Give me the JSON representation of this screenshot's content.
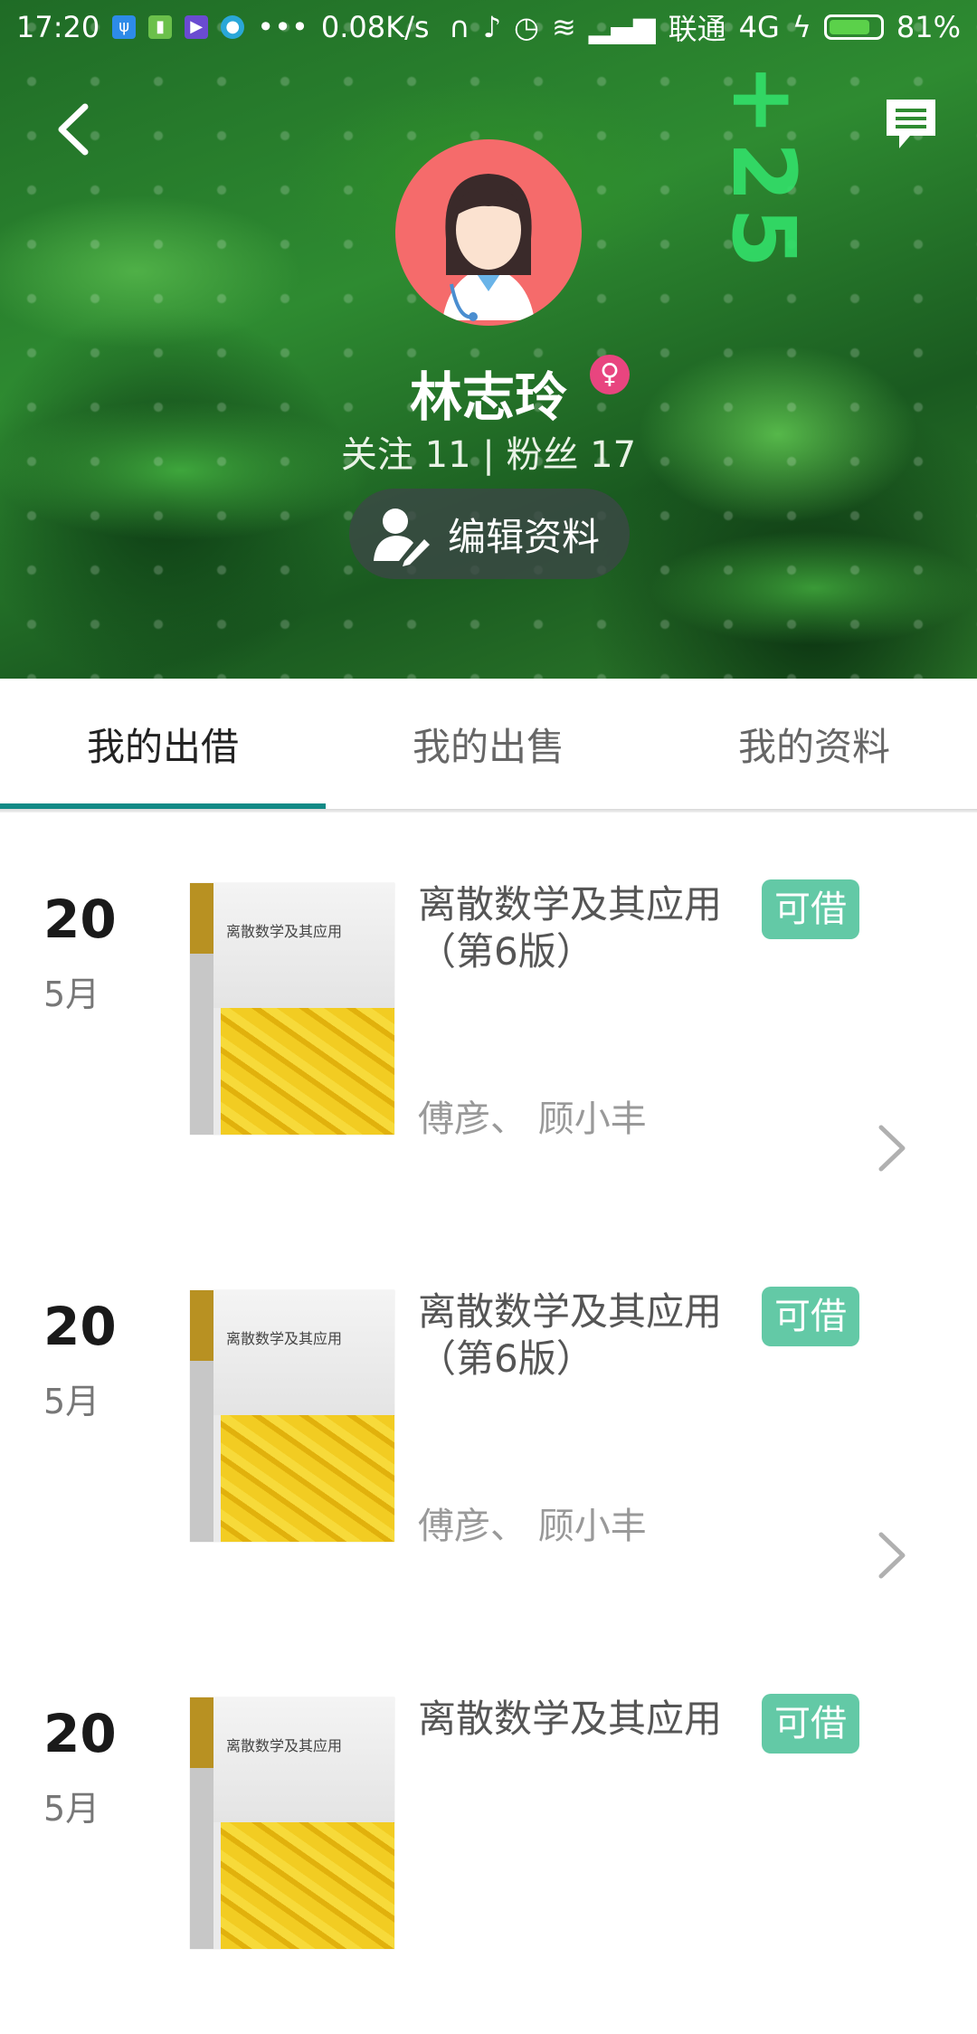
{
  "status_bar": {
    "time": "17:20",
    "network_speed": "0.08K/s",
    "carrier": "联通",
    "network_type": "4G",
    "battery_percent_text": "81%",
    "battery_level": 0.81
  },
  "header": {
    "username": "林志玲",
    "follow_stats": "关注 11 | 粉丝 17",
    "edit_profile_label": "编辑资料"
  },
  "tabs": [
    {
      "label": "我的出借",
      "active": true
    },
    {
      "label": "我的出售",
      "active": false
    },
    {
      "label": "我的资料",
      "active": false
    }
  ],
  "items": [
    {
      "day": "20",
      "month": "5月",
      "title": "离散数学及其应用（第6版）",
      "status": "可借",
      "author": "傅彦、 顾小丰",
      "cover_title": "离散数学及其应用"
    },
    {
      "day": "20",
      "month": "5月",
      "title": "离散数学及其应用（第6版）",
      "status": "可借",
      "author": "傅彦、 顾小丰",
      "cover_title": "离散数学及其应用"
    },
    {
      "day": "20",
      "month": "5月",
      "title": "离散数学及其应用",
      "status": "可借",
      "author": "",
      "cover_title": "离散数学及其应用"
    }
  ],
  "colors": {
    "tab_indicator": "#128a86",
    "status_tag": "#63c9a6",
    "avatar_bg": "#f56b6b",
    "gender_badge": "#e8457f"
  },
  "icons": {
    "back": "chevron-left-icon",
    "message": "chat-bubble-icon",
    "edit": "user-edit-icon",
    "gender": "female-icon",
    "row": "chevron-right-icon"
  }
}
